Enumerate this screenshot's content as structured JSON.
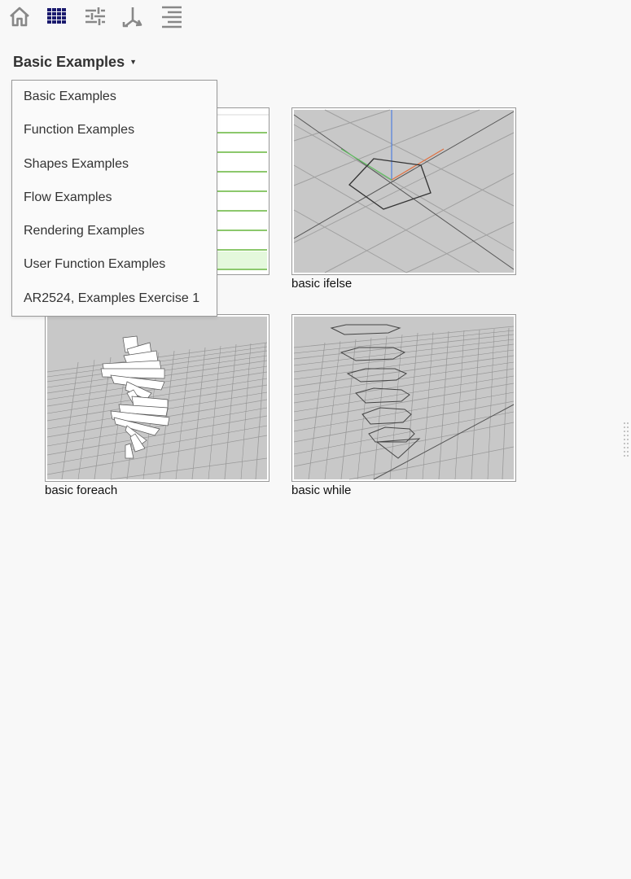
{
  "toolbar": {
    "icons": [
      "home-icon",
      "grid-icon",
      "sliders-icon",
      "merge-arrow-icon",
      "align-right-icon"
    ],
    "active_color": "#1a1a6e",
    "icon_color": "#888888"
  },
  "selector": {
    "current": "Basic Examples"
  },
  "menu": {
    "items": [
      "Basic Examples",
      "Function Examples",
      "Shapes Examples",
      "Flow Examples",
      "Rendering Examples",
      "User Function Examples",
      "AR2524, Examples Exercise 1"
    ]
  },
  "examples": [
    {
      "caption": ""
    },
    {
      "caption": "basic ifelse"
    },
    {
      "caption": "basic foreach"
    },
    {
      "caption": "basic while"
    }
  ],
  "colors": {
    "background": "#f8f8f8",
    "viewport_bg": "#c8c8c8",
    "axis_x": "#e07040",
    "axis_y": "#60c060",
    "axis_z": "#5080e0",
    "table_row": "#8cc86c"
  }
}
